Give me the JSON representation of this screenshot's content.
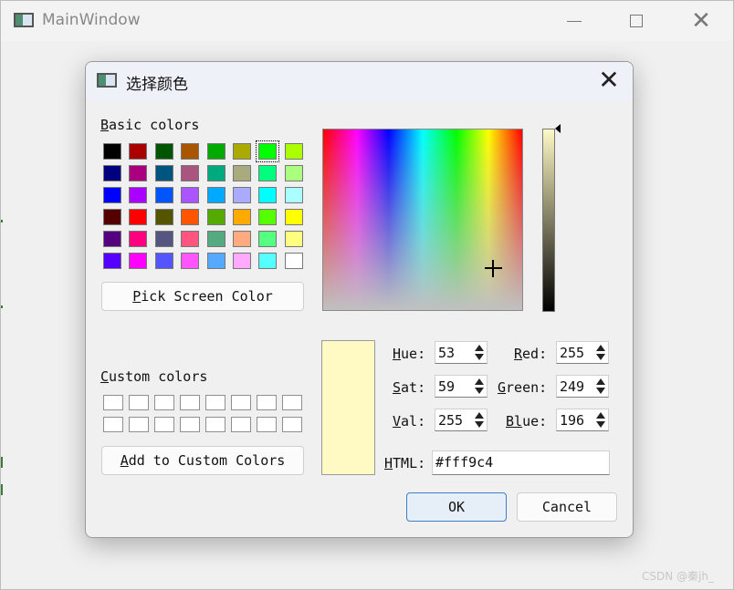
{
  "main_window": {
    "title": "MainWindow",
    "icon": "app-window-icon",
    "controls": [
      "minimize-icon",
      "maximize-icon",
      "close-icon"
    ],
    "close_glyph": "✕"
  },
  "dialog": {
    "title": "选择颜色",
    "icon": "app-window-icon",
    "close_glyph": "✕",
    "basic_colors": {
      "label_first": "B",
      "label_rest": "asic colors",
      "selected_index": 6,
      "colors": [
        "#000000",
        "#aa0000",
        "#005500",
        "#aa5500",
        "#00aa00",
        "#aaaa00",
        "#00ff00",
        "#aaff00",
        "#00007f",
        "#aa007f",
        "#00557f",
        "#aa557f",
        "#00aa7f",
        "#aaaa7f",
        "#00ff7f",
        "#aaff7f",
        "#0000ff",
        "#aa00ff",
        "#0055ff",
        "#aa55ff",
        "#00aaff",
        "#aaaaff",
        "#00ffff",
        "#aaffff",
        "#550000",
        "#ff0000",
        "#555500",
        "#ff5500",
        "#55aa00",
        "#ffaa00",
        "#55ff00",
        "#ffff00",
        "#55007f",
        "#ff007f",
        "#55557f",
        "#ff557f",
        "#55aa7f",
        "#ffaa7f",
        "#55ff7f",
        "#ffff7f",
        "#5500ff",
        "#ff00ff",
        "#5555ff",
        "#ff55ff",
        "#55aaff",
        "#ffaaff",
        "#55ffff",
        "#ffffff"
      ]
    },
    "pick_screen": {
      "first": "P",
      "rest": "ick Screen Color"
    },
    "custom_colors": {
      "label_first": "C",
      "label_rest": "ustom colors",
      "count": 16
    },
    "add_custom": {
      "first": "A",
      "rest": "dd to Custom Colors"
    },
    "current_color": "#fff9c4",
    "spectrum": {
      "hue": 53,
      "saturation": 59
    },
    "luminance": {
      "value": 255
    },
    "fields": {
      "hue": {
        "first": "H",
        "rest": "ue:",
        "value": "53"
      },
      "sat": {
        "first": "S",
        "rest": "at:",
        "value": "59"
      },
      "val": {
        "first": "V",
        "rest": "al:",
        "value": "255"
      },
      "red": {
        "first": "R",
        "rest": "ed:",
        "value": "255"
      },
      "green": {
        "first": "G",
        "rest": "reen:",
        "value": "249"
      },
      "blue": {
        "first": "Bl",
        "rest": "ue:",
        "value": "196"
      },
      "html": {
        "first": "H",
        "rest": "TML:",
        "value": "#fff9c4"
      }
    },
    "ok_label": "OK",
    "cancel_label": "Cancel"
  },
  "watermark": "CSDN @秦jh_"
}
